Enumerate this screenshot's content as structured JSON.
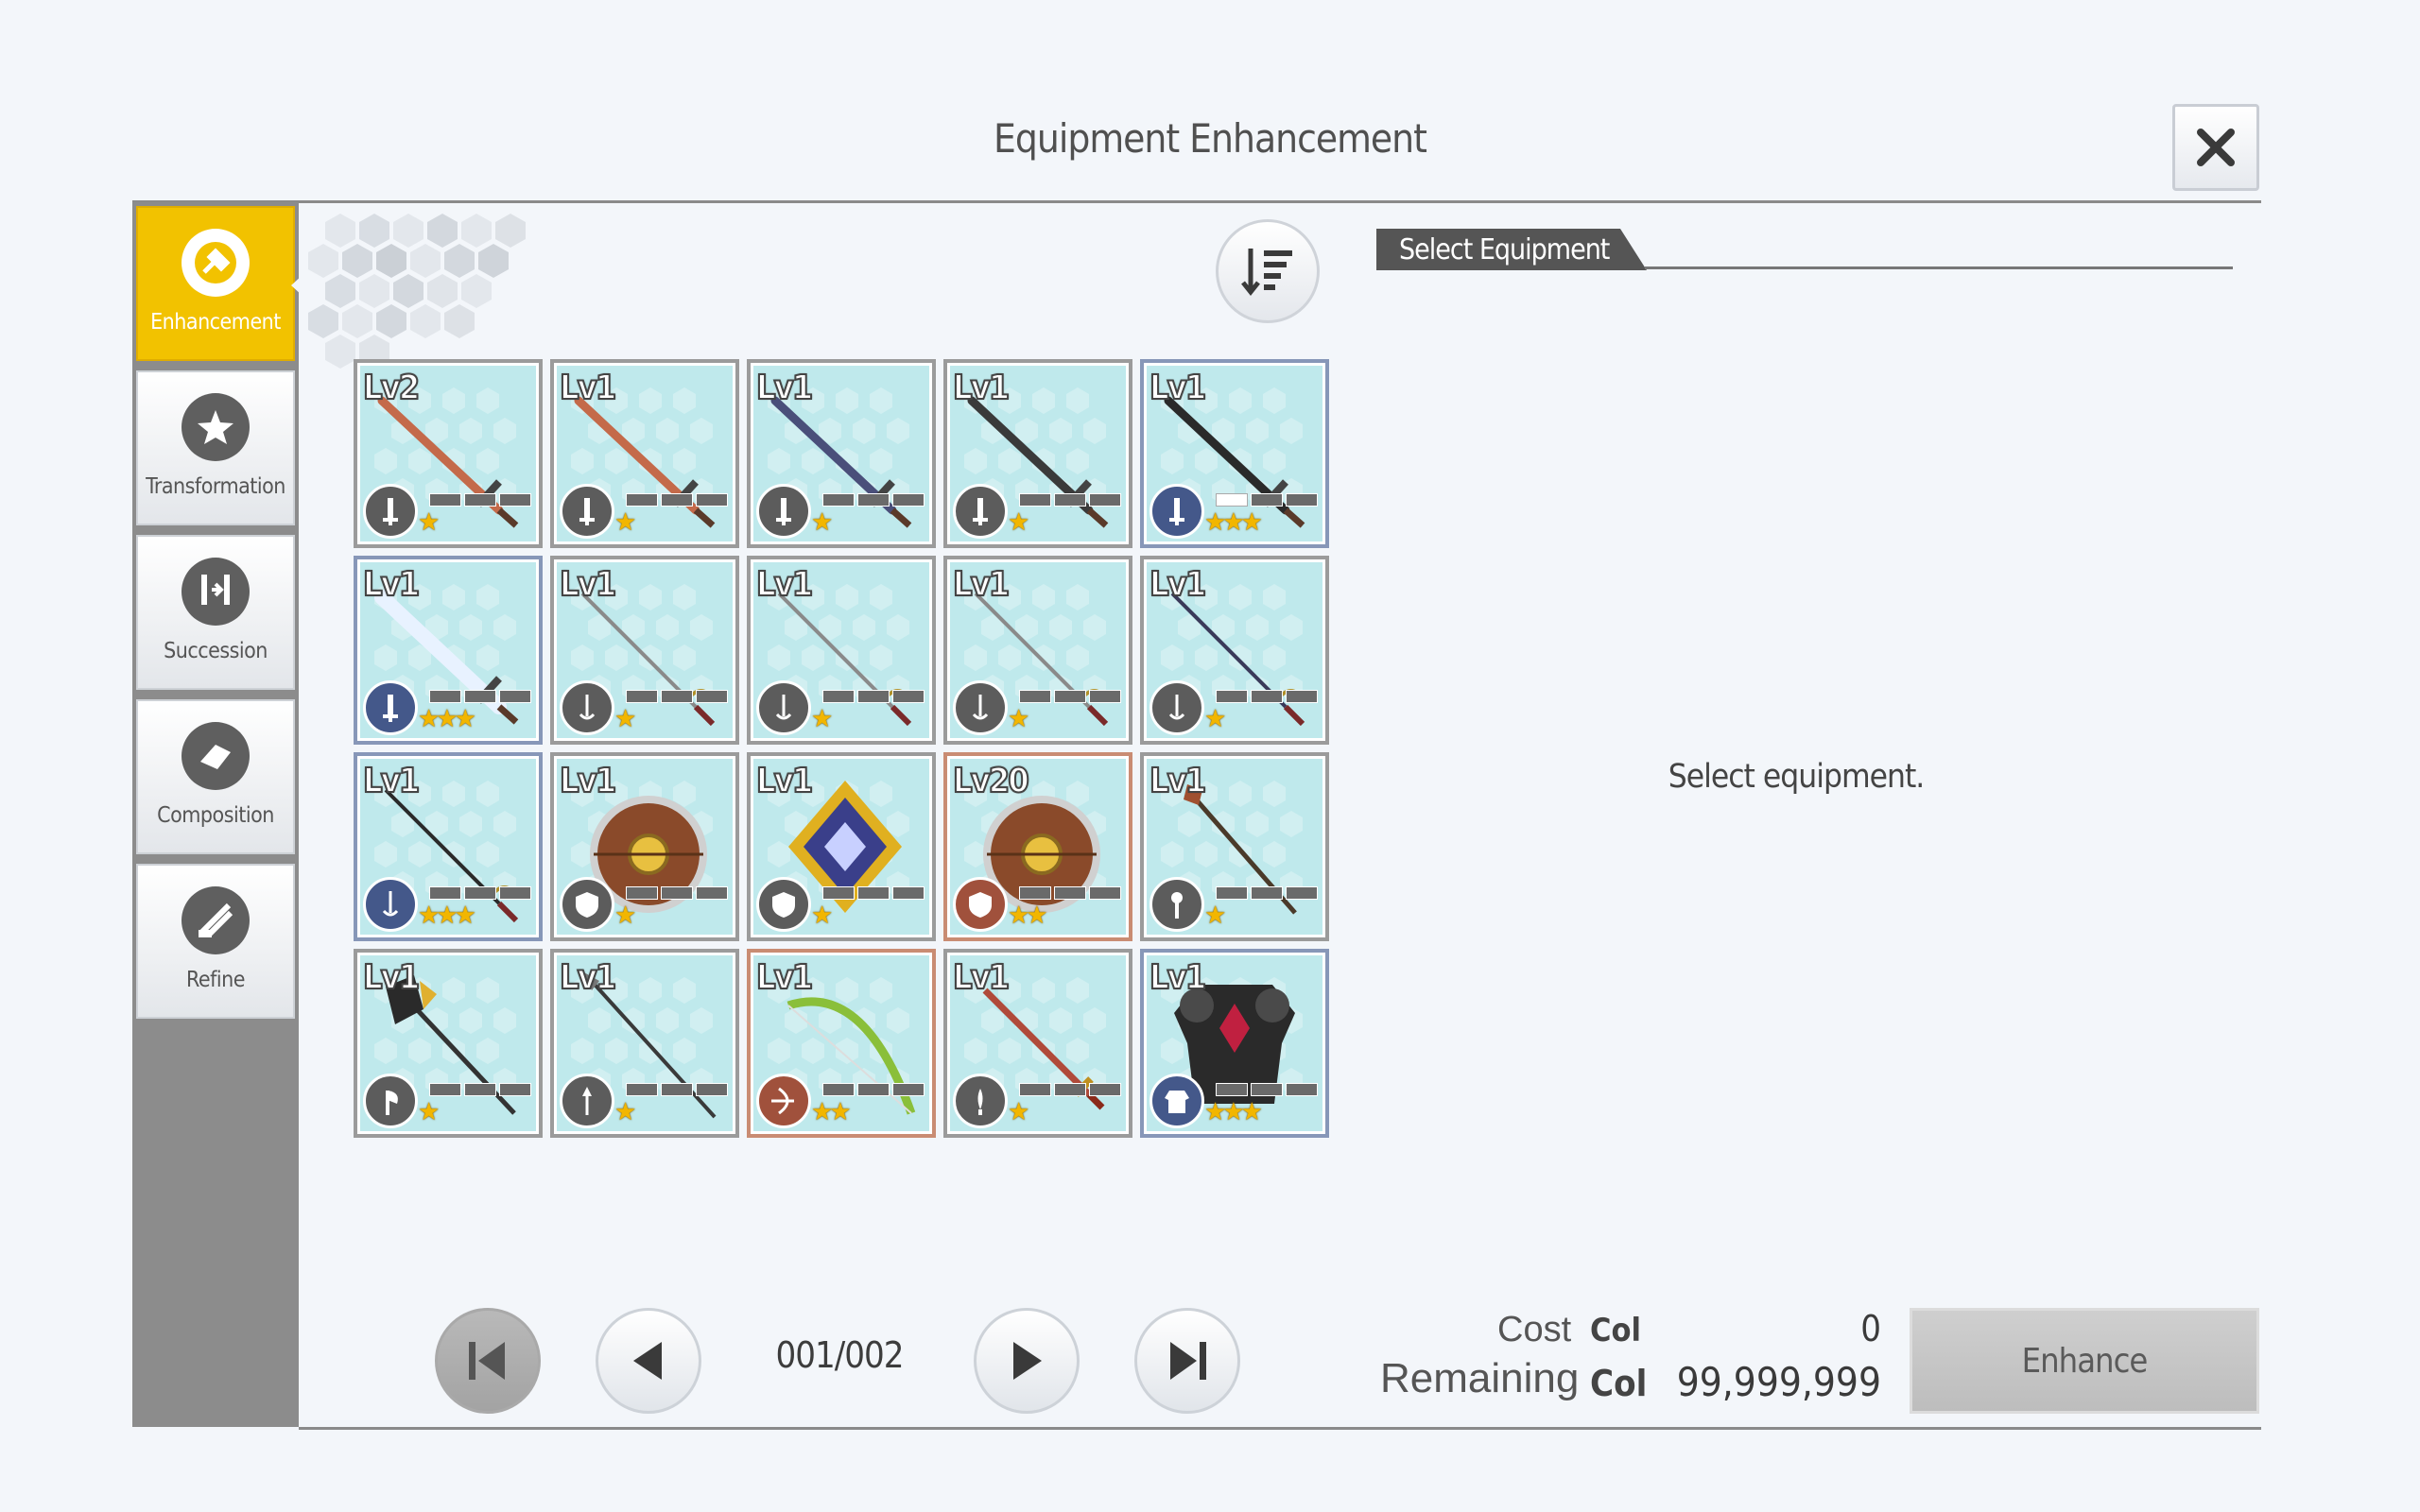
{
  "window": {
    "title": "Equipment Enhancement"
  },
  "sidebar": {
    "tabs": [
      {
        "label": "Enhancement",
        "icon": "enhancement-icon",
        "active": true
      },
      {
        "label": "Transformation",
        "icon": "transformation-icon",
        "active": false
      },
      {
        "label": "Succession",
        "icon": "succession-icon",
        "active": false
      },
      {
        "label": "Composition",
        "icon": "composition-icon",
        "active": false
      },
      {
        "label": "Refine",
        "icon": "refine-icon",
        "active": false
      }
    ]
  },
  "inventory": {
    "sort_icon": "sort-descending-icon",
    "items": [
      {
        "level": "Lv2",
        "kind": "sword",
        "badge": "sword-icon",
        "stars": 1,
        "frame": "grey",
        "color": "#c46a4a"
      },
      {
        "level": "Lv1",
        "kind": "sword",
        "badge": "sword-icon",
        "stars": 1,
        "frame": "grey",
        "color": "#c46a4a"
      },
      {
        "level": "Lv1",
        "kind": "sword",
        "badge": "sword-icon",
        "stars": 1,
        "frame": "grey",
        "color": "#4a4f7a"
      },
      {
        "level": "Lv1",
        "kind": "sword",
        "badge": "sword-icon",
        "stars": 1,
        "frame": "grey",
        "color": "#3a3a3a"
      },
      {
        "level": "Lv1",
        "kind": "sword",
        "badge": "sword-icon",
        "stars": 3,
        "frame": "blue",
        "color": "#2a2a2a"
      },
      {
        "level": "Lv1",
        "kind": "greatsword",
        "badge": "sword-icon",
        "stars": 3,
        "frame": "blue",
        "color": "#e8f2ff"
      },
      {
        "level": "Lv1",
        "kind": "rapier",
        "badge": "rapier-icon",
        "stars": 1,
        "frame": "grey",
        "color": "#8a8a8a"
      },
      {
        "level": "Lv1",
        "kind": "rapier",
        "badge": "rapier-icon",
        "stars": 1,
        "frame": "grey",
        "color": "#8a8a8a"
      },
      {
        "level": "Lv1",
        "kind": "rapier",
        "badge": "rapier-icon",
        "stars": 1,
        "frame": "grey",
        "color": "#8a8a8a"
      },
      {
        "level": "Lv1",
        "kind": "rapier",
        "badge": "rapier-icon",
        "stars": 1,
        "frame": "grey",
        "color": "#3a3a5a"
      },
      {
        "level": "Lv1",
        "kind": "rapier",
        "badge": "rapier-icon",
        "stars": 3,
        "frame": "blue",
        "color": "#2a2a2a"
      },
      {
        "level": "Lv1",
        "kind": "shield",
        "badge": "shield-icon",
        "stars": 1,
        "frame": "grey",
        "color": "#8a4a2a"
      },
      {
        "level": "Lv1",
        "kind": "crest-shield",
        "badge": "shield-icon",
        "stars": 1,
        "frame": "grey",
        "color": "#3a3f8a"
      },
      {
        "level": "Lv20",
        "kind": "shield",
        "badge": "shield-icon",
        "stars": 2,
        "frame": "red",
        "color": "#8a4a2a"
      },
      {
        "level": "Lv1",
        "kind": "mace",
        "badge": "mace-icon",
        "stars": 1,
        "frame": "grey",
        "color": "#4a3a2a"
      },
      {
        "level": "Lv1",
        "kind": "axe",
        "badge": "axe-icon",
        "stars": 1,
        "frame": "grey",
        "color": "#2a2a2a"
      },
      {
        "level": "Lv1",
        "kind": "spear",
        "badge": "spear-icon",
        "stars": 1,
        "frame": "grey",
        "color": "#3a3a3a"
      },
      {
        "level": "Lv1",
        "kind": "bow",
        "badge": "bow-icon",
        "stars": 2,
        "frame": "red",
        "color": "#8abf3a"
      },
      {
        "level": "Lv1",
        "kind": "dagger",
        "badge": "dagger-icon",
        "stars": 1,
        "frame": "grey",
        "color": "#b04a3a"
      },
      {
        "level": "Lv1",
        "kind": "armor",
        "badge": "armor-icon",
        "stars": 3,
        "frame": "blue",
        "color": "#2a2a2a"
      }
    ]
  },
  "details": {
    "section_label": "Select Equipment",
    "empty_message": "Select equipment."
  },
  "pager": {
    "page_text": "001/002"
  },
  "costs": {
    "cost_label": "Cost",
    "remaining_label": "Remaining",
    "currency": "Col",
    "cost_value": "0",
    "remaining_value": "99,999,999"
  },
  "actions": {
    "enhance_label": "Enhance"
  },
  "colors": {
    "accent": "#f2c200",
    "cell_bg": "#bfe9ec",
    "star": "#f2b600"
  }
}
